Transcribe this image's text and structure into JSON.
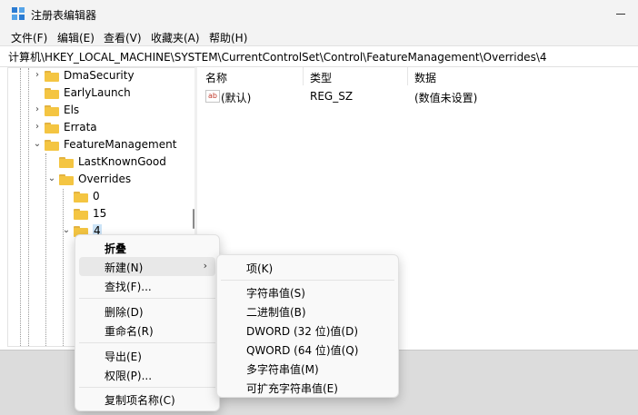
{
  "window": {
    "title": "注册表编辑器"
  },
  "menu": [
    "文件(F)",
    "编辑(E)",
    "查看(V)",
    "收藏夹(A)",
    "帮助(H)"
  ],
  "address": "计算机\\HKEY_LOCAL_MACHINE\\SYSTEM\\CurrentControlSet\\Control\\FeatureManagement\\Overrides\\4",
  "tree": [
    {
      "label": "DmaSecurity",
      "expanded": false
    },
    {
      "label": "EarlyLaunch",
      "expanded": null
    },
    {
      "label": "Els",
      "expanded": false
    },
    {
      "label": "Errata",
      "expanded": false
    },
    {
      "label": "FeatureManagement",
      "expanded": true
    },
    {
      "label": "LastKnownGood",
      "expanded": null
    },
    {
      "label": "Overrides",
      "expanded": true
    },
    {
      "label": "0",
      "expanded": null
    },
    {
      "label": "15",
      "expanded": null
    },
    {
      "label": "4",
      "expanded": true
    }
  ],
  "list": {
    "headers": [
      "名称",
      "类型",
      "数据"
    ],
    "rows": [
      {
        "name": "(默认)",
        "type": "REG_SZ",
        "data": "(数值未设置)",
        "icon": "ab"
      }
    ]
  },
  "context_menu": [
    {
      "label": "折叠",
      "bold": true
    },
    {
      "label": "新建(N)",
      "submenu": true
    },
    {
      "label": "查找(F)..."
    },
    {
      "label": "删除(D)"
    },
    {
      "label": "重命名(R)"
    },
    {
      "label": "导出(E)"
    },
    {
      "label": "权限(P)..."
    },
    {
      "label": "复制项名称(C)"
    }
  ],
  "submenu": [
    "项(K)",
    "字符串值(S)",
    "二进制值(B)",
    "DWORD (32 位)值(D)",
    "QWORD (64 位)值(Q)",
    "多字符串值(M)",
    "可扩充字符串值(E)"
  ],
  "colors": {
    "folder": "#f4c542",
    "hover": "#e8e8e8",
    "chrome": "#f3f3f3"
  }
}
